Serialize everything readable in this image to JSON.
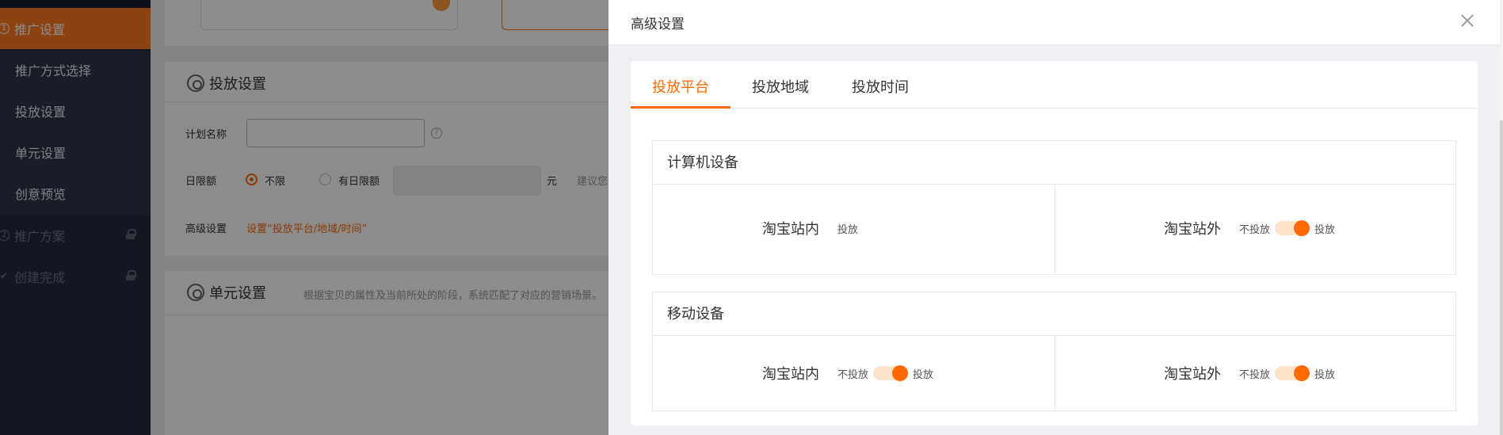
{
  "sidebar": {
    "step1": {
      "num": "1",
      "label": "推广设置"
    },
    "sub_items": [
      {
        "label": "推广方式选择"
      },
      {
        "label": "投放设置"
      },
      {
        "label": "单元设置"
      },
      {
        "label": "创意预览"
      }
    ],
    "step2": {
      "num": "2",
      "label": "推广方案"
    },
    "step3": {
      "label": "创建完成"
    }
  },
  "main": {
    "placement_section": {
      "title": "投放设置",
      "plan_name_label": "计划名称",
      "plan_name_value": "",
      "help_glyph": "?",
      "daily_budget_label": "日限额",
      "option_unlimited": "不限",
      "option_limited": "有日限额",
      "budget_value": "",
      "currency": "元",
      "hint": "建议您合",
      "advanced_label": "高级设置",
      "advanced_link": "设置“投放平台/地域/时间”"
    },
    "unit_section": {
      "title": "单元设置",
      "desc": "根据宝贝的属性及当前所处的阶段，系统匹配了对应的营销场景。"
    }
  },
  "drawer": {
    "title": "高级设置",
    "tabs": [
      {
        "label": "投放平台",
        "active": true
      },
      {
        "label": "投放地域",
        "active": false
      },
      {
        "label": "投放时间",
        "active": false
      }
    ],
    "sections": [
      {
        "title": "计算机设备",
        "cells": [
          {
            "name": "淘宝站内",
            "off_label": "",
            "on_label": "投放",
            "has_toggle": false
          },
          {
            "name": "淘宝站外",
            "off_label": "不投放",
            "on_label": "投放",
            "has_toggle": true,
            "value": "投放"
          }
        ]
      },
      {
        "title": "移动设备",
        "cells": [
          {
            "name": "淘宝站内",
            "off_label": "不投放",
            "on_label": "投放",
            "has_toggle": true,
            "value": "投放"
          },
          {
            "name": "淘宝站外",
            "off_label": "不投放",
            "on_label": "投放",
            "has_toggle": true,
            "value": "投放"
          }
        ]
      }
    ]
  },
  "colors": {
    "accent": "#ff6a00",
    "sidebar_bg": "#232a3d",
    "sidebar_active": "#ff7a1f",
    "toggle_track": "#fde2cc"
  }
}
